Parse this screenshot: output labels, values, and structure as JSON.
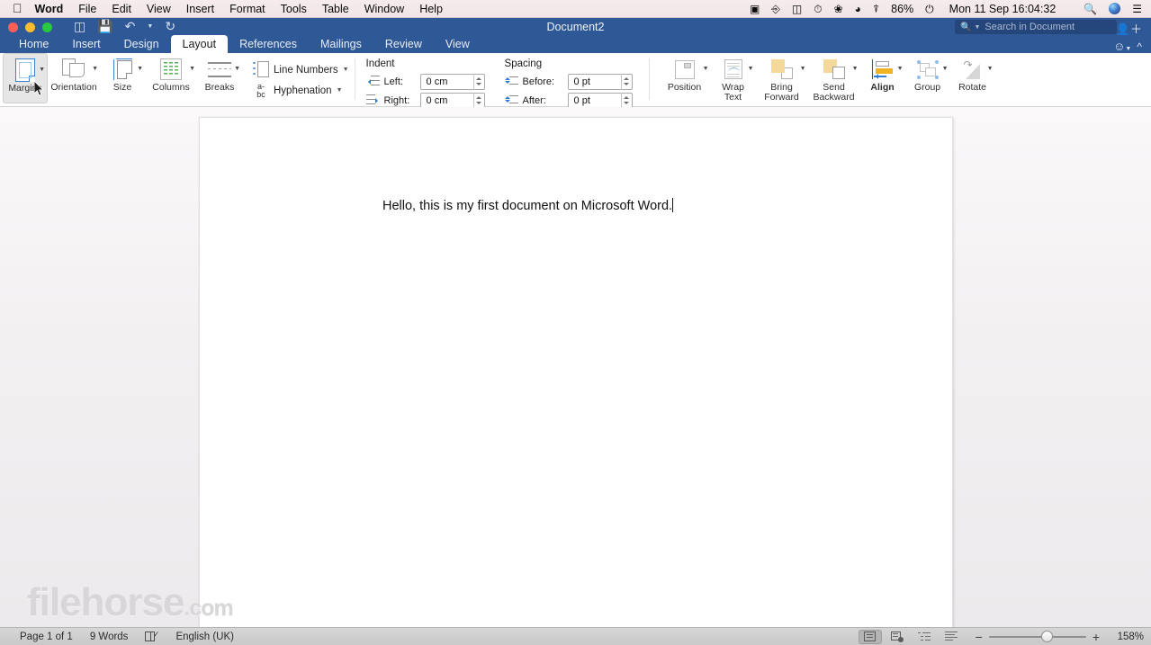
{
  "macos_menubar": {
    "apple_icon": "apple-logo",
    "items": [
      {
        "label": "Word",
        "bold": true
      },
      {
        "label": "File",
        "bold": false
      },
      {
        "label": "Edit",
        "bold": false
      },
      {
        "label": "View",
        "bold": false
      },
      {
        "label": "Insert",
        "bold": false
      },
      {
        "label": "Format",
        "bold": false
      },
      {
        "label": "Tools",
        "bold": false
      },
      {
        "label": "Table",
        "bold": false
      },
      {
        "label": "Window",
        "bold": false
      },
      {
        "label": "Help",
        "bold": false
      }
    ],
    "status_icons": [
      "screen-record-icon",
      "accessibility-icon",
      "display-icon",
      "time-machine-icon",
      "bluetooth-icon",
      "wifi-icon",
      "airplay-icon"
    ],
    "battery": "86%",
    "battery_icon": "battery-charging-icon",
    "clock": "Mon 11 Sep  16:04:32",
    "search_icon": "spotlight-search-icon",
    "siri_icon": "siri-icon",
    "notification_icon": "notification-center-icon"
  },
  "titlebar": {
    "document_title": "Document2",
    "traffic_lights": [
      "close-button",
      "minimize-button",
      "zoom-button"
    ],
    "quick_access": [
      "sidebar-toggle-icon",
      "save-icon",
      "undo-icon",
      "undo-dropdown-caret",
      "redo-icon"
    ],
    "search_placeholder": "Search in Document",
    "search_icon": "search-icon",
    "share_icon": "add-user-icon",
    "emoji_icon": "smiley-icon",
    "collapse_ribbon_icon": "chevron-up-icon"
  },
  "ribbon_tabs": {
    "tabs": [
      {
        "label": "Home",
        "active": false
      },
      {
        "label": "Insert",
        "active": false
      },
      {
        "label": "Design",
        "active": false
      },
      {
        "label": "Layout",
        "active": true
      },
      {
        "label": "References",
        "active": false
      },
      {
        "label": "Mailings",
        "active": false
      },
      {
        "label": "Review",
        "active": false
      },
      {
        "label": "View",
        "active": false
      }
    ]
  },
  "ribbon": {
    "page_setup": [
      {
        "label": "Margins",
        "icon": "margins-icon",
        "has_caret": true,
        "selected": true
      },
      {
        "label": "Orientation",
        "icon": "orientation-icon",
        "has_caret": true,
        "selected": false
      },
      {
        "label": "Size",
        "icon": "page-size-icon",
        "has_caret": true,
        "selected": false
      },
      {
        "label": "Columns",
        "icon": "columns-icon",
        "has_caret": true,
        "selected": false
      },
      {
        "label": "Breaks",
        "icon": "breaks-icon",
        "has_caret": true,
        "selected": false
      }
    ],
    "page_setup_small": [
      {
        "label": "Line Numbers",
        "icon": "line-numbers-icon",
        "has_caret": true
      },
      {
        "label": "Hyphenation",
        "icon": "hyphenation-icon",
        "has_caret": true
      }
    ],
    "indent": {
      "header": "Indent",
      "left_label": "Left:",
      "left_value": "0 cm",
      "left_icon": "indent-left-icon",
      "right_label": "Right:",
      "right_value": "0 cm",
      "right_icon": "indent-right-icon"
    },
    "spacing": {
      "header": "Spacing",
      "before_label": "Before:",
      "before_value": "0 pt",
      "before_icon": "spacing-before-icon",
      "after_label": "After:",
      "after_value": "0 pt",
      "after_icon": "spacing-after-icon"
    },
    "arrange": [
      {
        "label": "Position",
        "label2": "",
        "icon": "position-icon",
        "has_caret": true,
        "bold": false
      },
      {
        "label": "Wrap",
        "label2": "Text",
        "icon": "wrap-text-icon",
        "has_caret": true,
        "bold": false
      },
      {
        "label": "Bring",
        "label2": "Forward",
        "icon": "bring-forward-icon",
        "has_caret": true,
        "bold": false
      },
      {
        "label": "Send",
        "label2": "Backward",
        "icon": "send-backward-icon",
        "has_caret": true,
        "bold": false
      },
      {
        "label": "Align",
        "label2": "",
        "icon": "align-objects-icon",
        "has_caret": true,
        "bold": true
      },
      {
        "label": "Group",
        "label2": "",
        "icon": "group-icon",
        "has_caret": true,
        "bold": false
      },
      {
        "label": "Rotate",
        "label2": "",
        "icon": "rotate-icon",
        "has_caret": true,
        "bold": false
      }
    ]
  },
  "document": {
    "body_text": "Hello, this is my first document on Microsoft Word.",
    "watermark_main": "filehorse",
    "watermark_suffix": ".com"
  },
  "statusbar": {
    "page_info": "Page 1 of 1",
    "word_count": "9 Words",
    "proofing_icon": "proofing-check-icon",
    "language": "English (UK)",
    "views": [
      {
        "name": "print-layout-view",
        "active": true
      },
      {
        "name": "web-layout-view",
        "active": false
      },
      {
        "name": "outline-view",
        "active": false
      },
      {
        "name": "draft-view",
        "active": false
      }
    ],
    "zoom_minus": "−",
    "zoom_plus": "+",
    "zoom_value": "158%"
  },
  "colors": {
    "ribbon_blue": "#2f5897",
    "macbar_pink": "#f2e7e9",
    "accent_blue": "#3f7fd4",
    "align_gold": "#f0b323"
  }
}
